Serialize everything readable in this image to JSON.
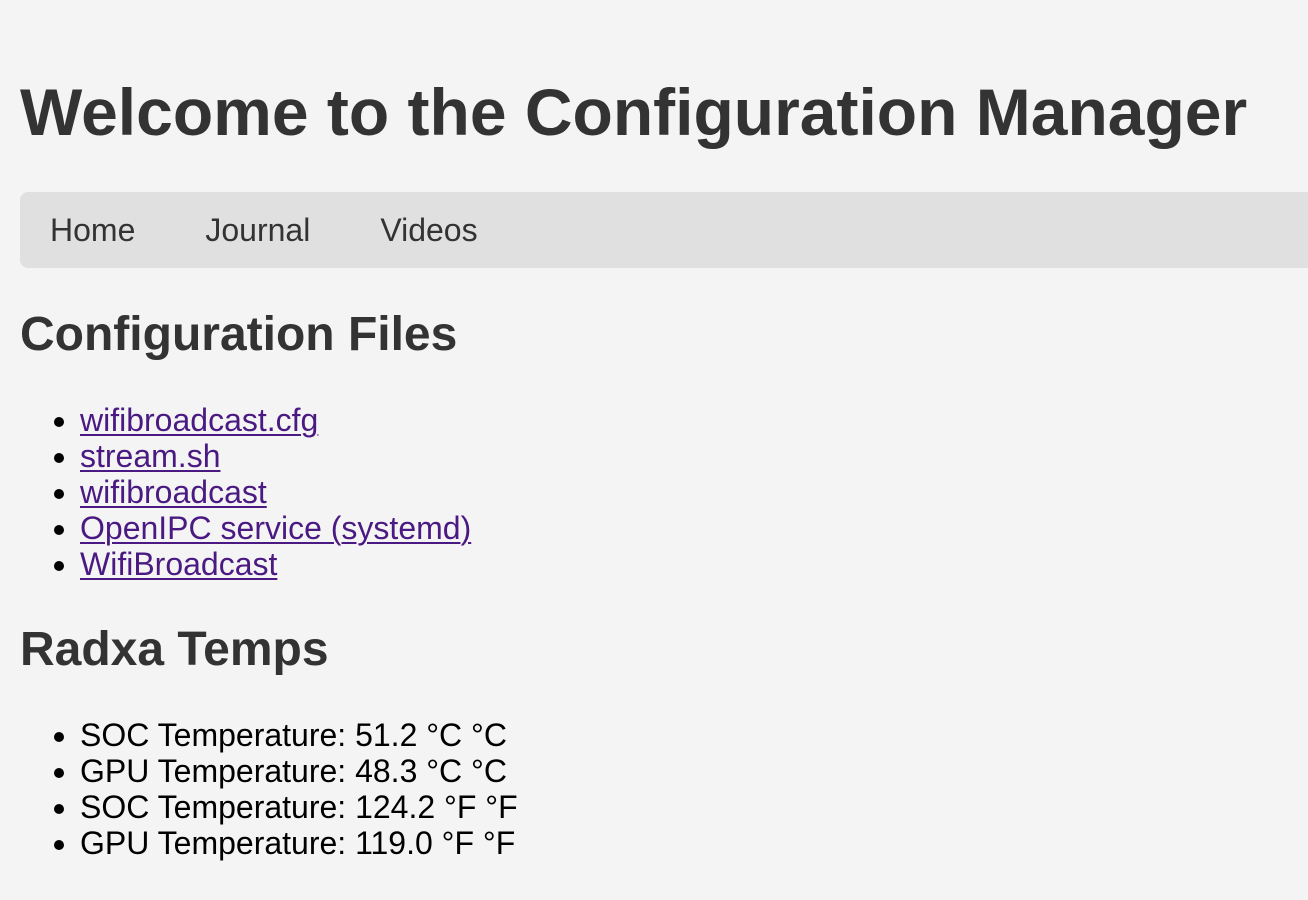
{
  "page": {
    "title": "Welcome to the Configuration Manager"
  },
  "nav": {
    "items": [
      {
        "label": "Home"
      },
      {
        "label": "Journal"
      },
      {
        "label": "Videos"
      }
    ]
  },
  "config_section": {
    "heading": "Configuration Files",
    "links": [
      {
        "label": "wifibroadcast.cfg"
      },
      {
        "label": "stream.sh"
      },
      {
        "label": "wifibroadcast"
      },
      {
        "label": "OpenIPC service (systemd)"
      },
      {
        "label": "WifiBroadcast"
      }
    ]
  },
  "temps_section": {
    "heading": "Radxa Temps",
    "items": [
      {
        "text": "SOC Temperature: 51.2 °C °C"
      },
      {
        "text": "GPU Temperature: 48.3 °C °C"
      },
      {
        "text": "SOC Temperature: 124.2 °F °F"
      },
      {
        "text": "GPU Temperature: 119.0 °F °F"
      }
    ]
  },
  "colors": {
    "background": "#f4f4f4",
    "navbar": "#e0e0e0",
    "heading_text": "#333333",
    "link_visited": "#4a1a82",
    "body_text": "#000000"
  }
}
